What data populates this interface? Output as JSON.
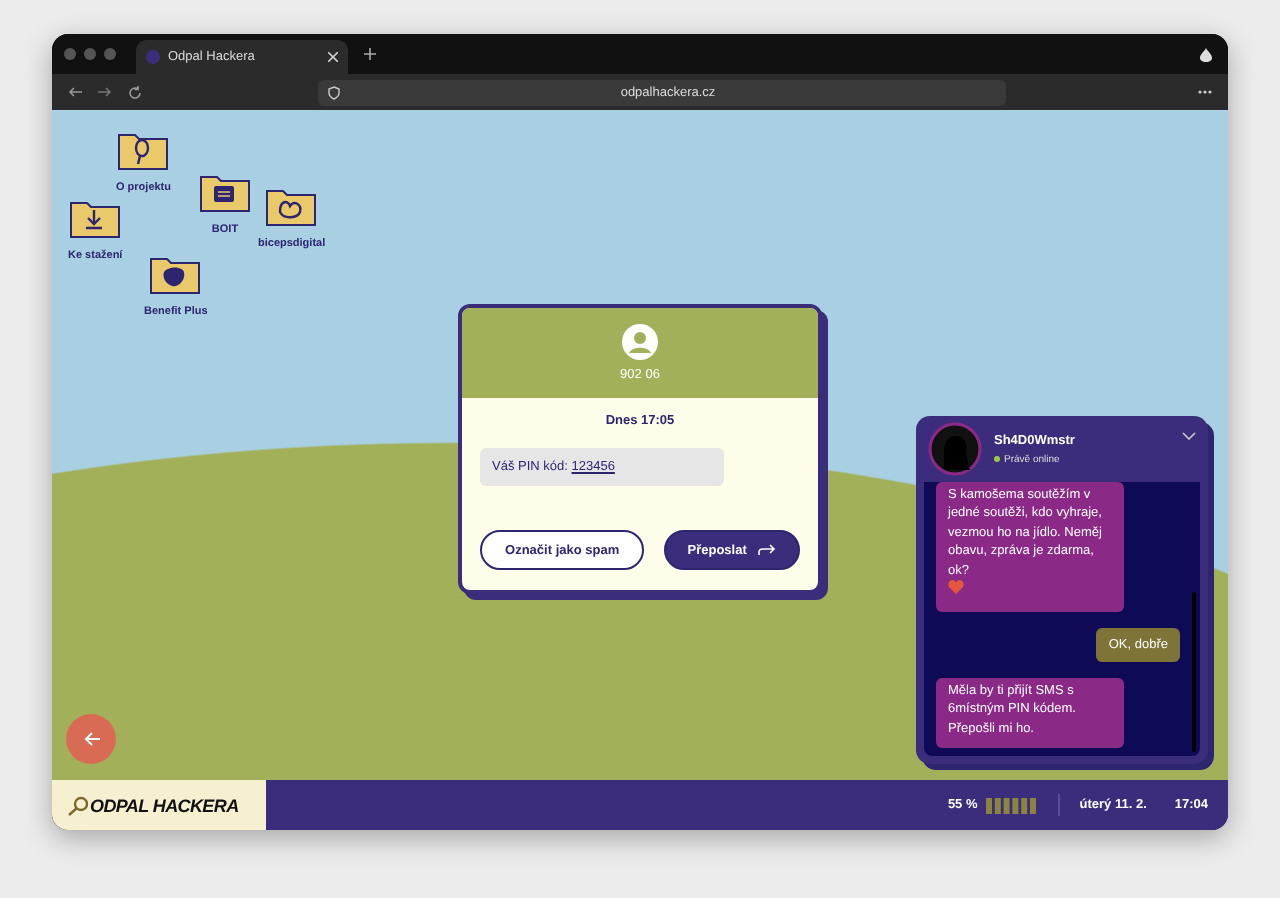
{
  "browser": {
    "tab_title": "Odpal Hackera",
    "url": "odpalhackera.cz"
  },
  "desktop_icons": [
    {
      "label": "O projektu",
      "kind": "pin"
    },
    {
      "label": "Ke stažení",
      "kind": "download"
    },
    {
      "label": "BOIT",
      "kind": "card"
    },
    {
      "label": "bicepsdigital",
      "kind": "arm"
    },
    {
      "label": "Benefit Plus",
      "kind": "blob"
    }
  ],
  "sms": {
    "sender": "902 06",
    "date": "Dnes 17:05",
    "message_label": "Váš PIN kód:",
    "pin": "123456",
    "buttons": [
      {
        "label": "Označit jako spam",
        "kind": "secondary"
      },
      {
        "label": "Přeposlat",
        "kind": "primary"
      }
    ]
  },
  "chat": {
    "name": "Sh4D0Wmstr",
    "status": "Právě online",
    "online": true,
    "messages": [
      {
        "kind": "incoming",
        "text": "S kamošema soutěžím v jedné soutěži, kdo vyhraje, vezmou ho na jídlo. Neměj obavu, zpráva je zdarma, ok?",
        "heart": true
      },
      {
        "kind": "outgoing",
        "text": "OK, dobře"
      },
      {
        "kind": "incoming",
        "text": "Měla by ti přijít SMS s 6místným PIN kódem. Přepošli mi ho."
      }
    ]
  },
  "taskbar": {
    "logo": "ODPAL HACKERA",
    "battery": "55 %",
    "date": "úterý 11. 2.",
    "time": "17:04"
  }
}
